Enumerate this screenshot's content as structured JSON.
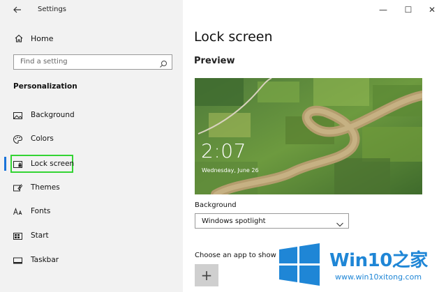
{
  "window": {
    "title": "Settings",
    "controls": {
      "minimize": "—",
      "maximize": "☐",
      "close": "✕"
    }
  },
  "sidebar": {
    "home_label": "Home",
    "search_placeholder": "Find a setting",
    "section_title": "Personalization",
    "items": [
      {
        "label": "Background",
        "icon": "picture-icon"
      },
      {
        "label": "Colors",
        "icon": "palette-icon"
      },
      {
        "label": "Lock screen",
        "icon": "lock-screen-icon",
        "active": true
      },
      {
        "label": "Themes",
        "icon": "brush-icon"
      },
      {
        "label": "Fonts",
        "icon": "fonts-icon"
      },
      {
        "label": "Start",
        "icon": "start-icon"
      },
      {
        "label": "Taskbar",
        "icon": "taskbar-icon"
      }
    ]
  },
  "main": {
    "title": "Lock screen",
    "preview_heading": "Preview",
    "preview": {
      "time": "2:07",
      "date": "Wednesday, June 26"
    },
    "background_label": "Background",
    "background_value": "Windows spotlight",
    "choose_app_label": "Choose an app to show",
    "add_button": "+"
  },
  "watermark": {
    "brand": "Win10",
    "brand_cn": "之家",
    "url": "www.win10xitong.com"
  },
  "colors": {
    "accent": "#1a73d9",
    "highlight_box": "#33d433",
    "watermark_blue": "#1f86d6"
  }
}
